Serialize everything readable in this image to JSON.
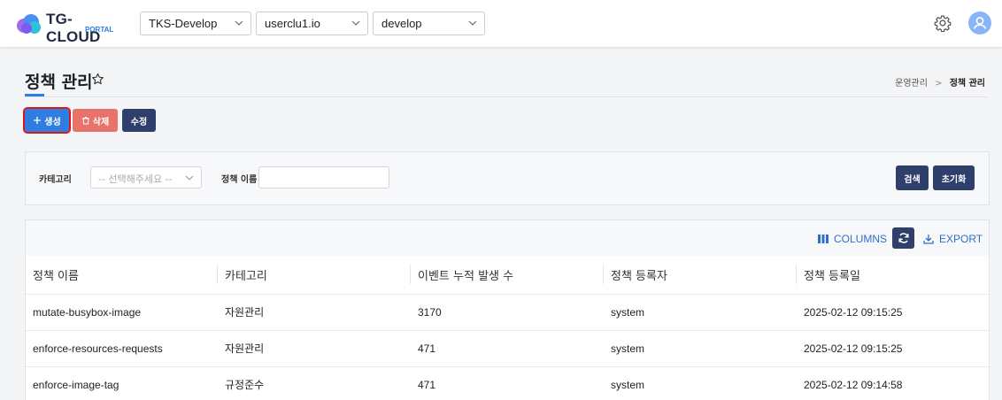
{
  "header": {
    "logo_text": "TG-CLOUD",
    "logo_sub": "PORTAL",
    "selects": [
      {
        "value": "TKS-Develop"
      },
      {
        "value": "userclu1.io"
      },
      {
        "value": "develop"
      }
    ],
    "icons": {
      "settings": "gear-icon",
      "user": "user-icon"
    }
  },
  "page": {
    "title": "정책 관리",
    "breadcrumb": {
      "parent": "운영관리",
      "current": "정책 관리"
    }
  },
  "actions": {
    "create_label": "생성",
    "delete_label": "삭제",
    "edit_label": "수정"
  },
  "filter": {
    "category_label": "카테고리",
    "category_placeholder": "-- 선택해주세요 --",
    "name_label": "정책 이름",
    "name_value": "",
    "search_label": "검색",
    "reset_label": "초기화"
  },
  "table": {
    "columns_label": "COLUMNS",
    "export_label": "EXPORT",
    "headers": [
      "정책 이름",
      "카테고리",
      "이벤트 누적 발생 수",
      "정책 등록자",
      "정책 등록일"
    ],
    "rows": [
      [
        "mutate-busybox-image",
        "자원관리",
        "3170",
        "system",
        "2025-02-12 09:15:25"
      ],
      [
        "enforce-resources-requests",
        "자원관리",
        "471",
        "system",
        "2025-02-12 09:15:25"
      ],
      [
        "enforce-image-tag",
        "규정준수",
        "471",
        "system",
        "2025-02-12 09:14:58"
      ]
    ]
  },
  "colors": {
    "accent": "#2f7de1",
    "navy": "#2e3f6b",
    "danger": "#e8736a",
    "highlight": "#d9151e"
  }
}
